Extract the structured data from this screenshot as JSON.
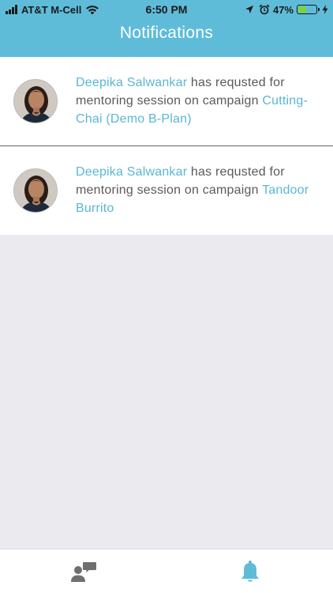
{
  "status_bar": {
    "carrier": "AT&T M-Cell",
    "time": "6:50 PM",
    "battery": "47%",
    "battery_level": 0.47,
    "icons": [
      "signal-icon",
      "wifi-icon",
      "location-icon",
      "alarm-icon",
      "battery-icon",
      "charging-icon"
    ]
  },
  "header": {
    "title": "Notifications",
    "background_color": "#5ebcd9"
  },
  "notifications": [
    {
      "name": "Deepika Salwankar",
      "message": " has requsted for mentoring session on campaign ",
      "campaign": "Cutting-Chai (Demo B-Plan)"
    },
    {
      "name": "Deepika Salwankar",
      "message": " has requsted for mentoring session on campaign ",
      "campaign": "Tandoor Burrito"
    }
  ],
  "tabbar": {
    "tabs": [
      {
        "icon": "people-chat-icon",
        "active": false
      },
      {
        "icon": "bell-icon",
        "active": true
      }
    ],
    "active_color": "#5ebcd9",
    "inactive_color": "#6f6f6f"
  },
  "colors": {
    "accent": "#5ab7d3",
    "body_text": "#5a5a5a",
    "background": "#ebebef"
  }
}
